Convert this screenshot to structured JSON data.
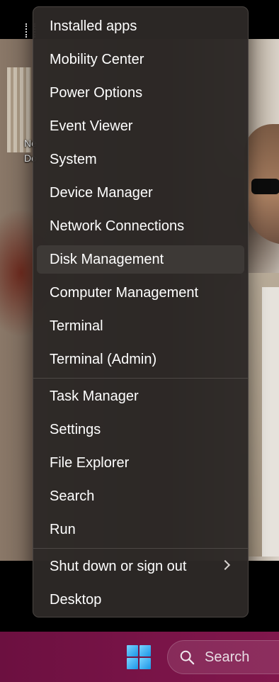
{
  "desktop": {
    "icon_label": "Ne\nDo"
  },
  "menu": {
    "groups": [
      {
        "items": [
          {
            "label": "Installed apps"
          },
          {
            "label": "Mobility Center"
          },
          {
            "label": "Power Options"
          },
          {
            "label": "Event Viewer"
          },
          {
            "label": "System"
          },
          {
            "label": "Device Manager"
          },
          {
            "label": "Network Connections"
          },
          {
            "label": "Disk Management",
            "hovered": true
          },
          {
            "label": "Computer Management"
          },
          {
            "label": "Terminal"
          },
          {
            "label": "Terminal (Admin)"
          }
        ]
      },
      {
        "items": [
          {
            "label": "Task Manager"
          },
          {
            "label": "Settings"
          },
          {
            "label": "File Explorer"
          },
          {
            "label": "Search"
          },
          {
            "label": "Run"
          }
        ]
      },
      {
        "items": [
          {
            "label": "Shut down or sign out",
            "submenu_icon": "chevron-right-icon"
          },
          {
            "label": "Desktop"
          }
        ]
      }
    ]
  },
  "taskbar": {
    "start_icon": "windows-logo-icon",
    "search_icon": "search-icon",
    "search_label": "Search",
    "colors": {
      "taskbar": "#7a1448",
      "menu_background": "#2c2826",
      "menu_hover": "#3d3936",
      "windows_logo": "#1a96e6"
    }
  }
}
